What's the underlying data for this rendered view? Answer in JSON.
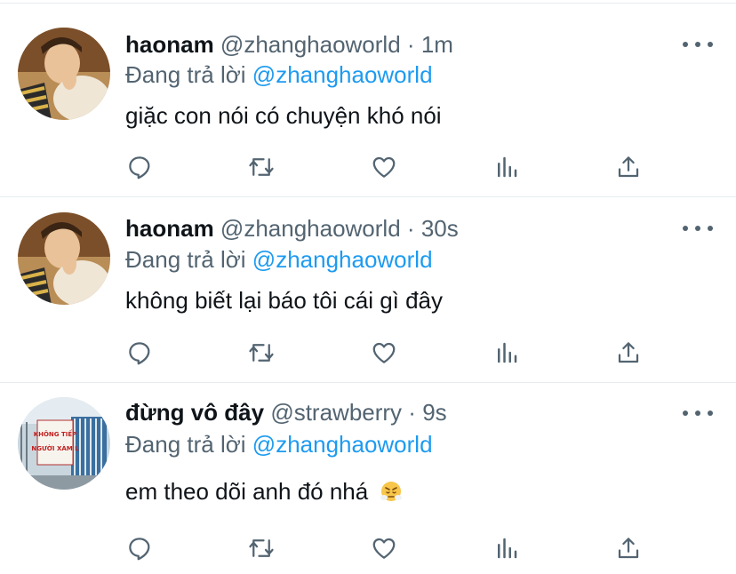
{
  "tweets": [
    {
      "name": "haonam",
      "handle": "@zhanghaoworld",
      "separator": "·",
      "time": "1m",
      "reply_prefix": "Đang trả lời",
      "reply_to": "@zhanghaoworld",
      "text": "giặc con nói có chuyện khó nói",
      "avatar": "person-avatar"
    },
    {
      "name": "haonam",
      "handle": "@zhanghaoworld",
      "separator": "·",
      "time": "30s",
      "reply_prefix": "Đang trả lời",
      "reply_to": "@zhanghaoworld",
      "text": "không biết lại báo tôi cái gì đây",
      "avatar": "person-avatar"
    },
    {
      "name": "đừng vô đây",
      "handle": "@strawberry",
      "separator": "·",
      "time": "9s",
      "reply_prefix": "Đang trả lời",
      "reply_to": "@zhanghaoworld",
      "text": "em theo dõi anh đó nhá",
      "text_emoji": "steam-from-nose-emoji",
      "avatar": "sign-avatar"
    }
  ],
  "avatar_sign_text": [
    "KHÔNG TIẾP",
    "NGƯỜI XÀM L"
  ],
  "actions": [
    "reply-icon",
    "retweet-icon",
    "like-icon",
    "analytics-icon",
    "share-icon"
  ],
  "colors": {
    "name": "#0f1419",
    "muted": "#536471",
    "link": "#1d9bf0",
    "divider": "#e6ecf0"
  }
}
